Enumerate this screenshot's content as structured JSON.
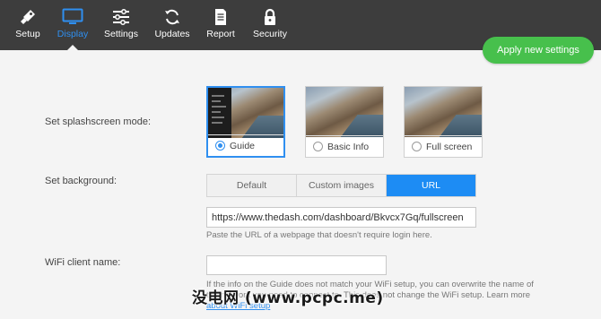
{
  "nav": {
    "items": [
      {
        "label": "Setup",
        "icon": "rocket-icon"
      },
      {
        "label": "Display",
        "icon": "monitor-icon",
        "active": true
      },
      {
        "label": "Settings",
        "icon": "sliders-icon"
      },
      {
        "label": "Updates",
        "icon": "refresh-icon"
      },
      {
        "label": "Report",
        "icon": "document-icon"
      },
      {
        "label": "Security",
        "icon": "lock-icon"
      }
    ],
    "active_color": "#2f8ff0"
  },
  "apply_button": {
    "label": "Apply new settings",
    "color": "#47c04c"
  },
  "splash": {
    "label": "Set splashscreen mode:",
    "options": [
      {
        "label": "Guide",
        "selected": true
      },
      {
        "label": "Basic Info",
        "selected": false
      },
      {
        "label": "Full screen",
        "selected": false
      }
    ]
  },
  "background": {
    "label": "Set background:",
    "options": [
      "Default",
      "Custom images",
      "URL"
    ],
    "selected": "URL",
    "url_value": "https://www.thedash.com/dashboard/Bkvcx7Gq/fullscreen",
    "help": "Paste the URL of a webpage that doesn't require login here."
  },
  "wifi": {
    "label": "WiFi client name:",
    "value": "",
    "help_line1": "If the info on the Guide does not match your WiFi setup, you can overwrite the name of",
    "help_line2": "the network you need to connect to. This does not change the WiFi setup. Learn more",
    "help_link": "about WiFi setup"
  },
  "watermark": "没电网 (www.pcpc.me)"
}
